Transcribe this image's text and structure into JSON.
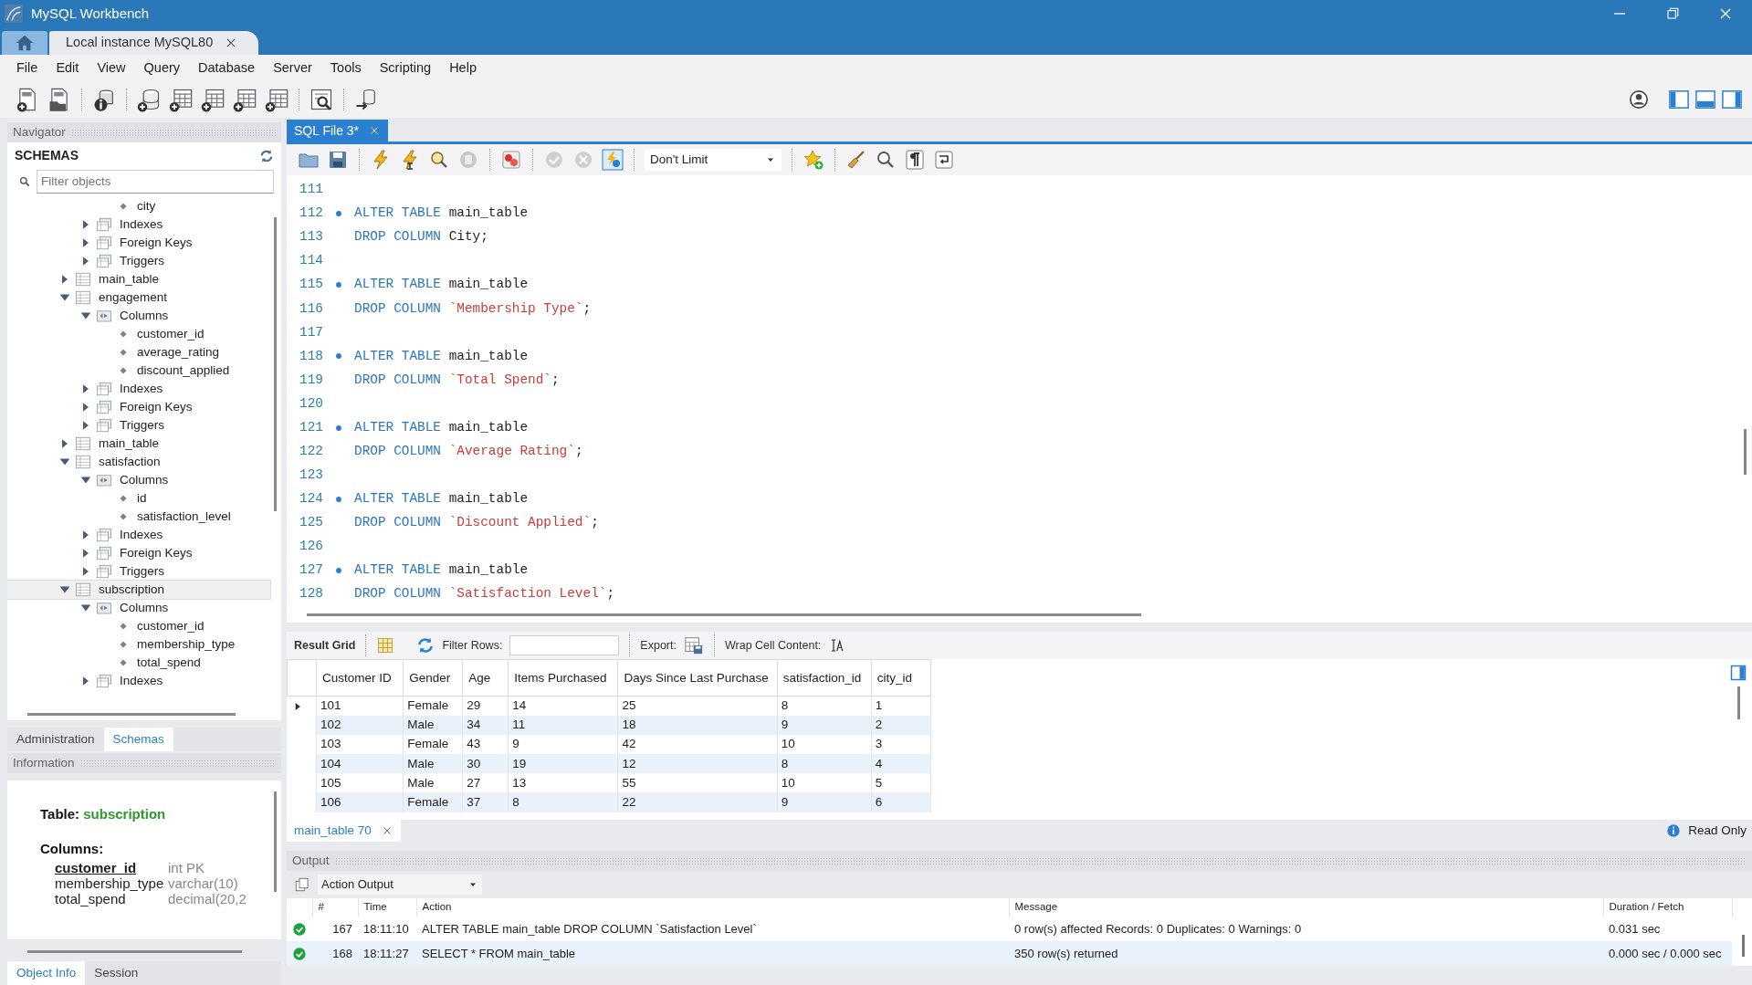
{
  "window": {
    "title": "MySQL Workbench"
  },
  "connection_tabs": [
    {
      "label": "Local instance MySQL80",
      "selected": true
    }
  ],
  "menu": [
    "File",
    "Edit",
    "View",
    "Query",
    "Database",
    "Server",
    "Tools",
    "Scripting",
    "Help"
  ],
  "navigator": {
    "title": "Navigator",
    "schemas_title": "SCHEMAS",
    "filter": {
      "placeholder": "Filter objects"
    },
    "tree": [
      {
        "children": [
          {
            "children": [
              {
                "label": "city",
                "kind": "column",
                "selected": false
              }
            ]
          },
          {
            "label": "Indexes",
            "kind": "group",
            "expanded": false,
            "selected": false
          },
          {
            "label": "Foreign Keys",
            "kind": "group",
            "expanded": false,
            "selected": false
          },
          {
            "label": "Triggers",
            "kind": "group",
            "expanded": false,
            "selected": false
          }
        ]
      },
      {
        "label": "main_table",
        "kind": "table",
        "expanded": false,
        "selected": false
      },
      {
        "label": "engagement",
        "kind": "table",
        "expanded": true,
        "selected": false,
        "children": [
          {
            "label": "Columns",
            "kind": "folder",
            "expanded": true,
            "selected": false,
            "children": [
              {
                "label": "customer_id",
                "kind": "column",
                "selected": false
              },
              {
                "label": "average_rating",
                "kind": "column",
                "selected": false
              },
              {
                "label": "discount_applied",
                "kind": "column",
                "selected": false
              }
            ]
          },
          {
            "label": "Indexes",
            "kind": "group",
            "expanded": false,
            "selected": false
          },
          {
            "label": "Foreign Keys",
            "kind": "group",
            "expanded": false,
            "selected": false
          },
          {
            "label": "Triggers",
            "kind": "group",
            "expanded": false,
            "selected": false
          }
        ]
      },
      {
        "label": "main_table",
        "kind": "table",
        "expanded": false,
        "selected": false
      },
      {
        "label": "satisfaction",
        "kind": "table",
        "expanded": true,
        "selected": false,
        "children": [
          {
            "label": "Columns",
            "kind": "folder",
            "expanded": true,
            "selected": false,
            "children": [
              {
                "label": "id",
                "kind": "column",
                "selected": false
              },
              {
                "label": "satisfaction_level",
                "kind": "column",
                "selected": false
              }
            ]
          },
          {
            "label": "Indexes",
            "kind": "group",
            "expanded": false,
            "selected": false
          },
          {
            "label": "Foreign Keys",
            "kind": "group",
            "expanded": false,
            "selected": false
          },
          {
            "label": "Triggers",
            "kind": "group",
            "expanded": false,
            "selected": false
          }
        ]
      },
      {
        "label": "subscription",
        "kind": "table",
        "expanded": true,
        "selected": true,
        "children": [
          {
            "label": "Columns",
            "kind": "folder",
            "expanded": true,
            "selected": false,
            "children": [
              {
                "label": "customer_id",
                "kind": "column",
                "selected": false
              },
              {
                "label": "membership_type",
                "kind": "column",
                "selected": false
              },
              {
                "label": "total_spend",
                "kind": "column",
                "selected": false
              }
            ]
          },
          {
            "label": "Indexes",
            "kind": "group",
            "expanded": false,
            "selected": false
          }
        ]
      }
    ]
  },
  "sidebar_tabs": [
    {
      "label": "Administration",
      "selected": false
    },
    {
      "label": "Schemas",
      "selected": true
    }
  ],
  "information": {
    "title": "Information",
    "table_label": "Table:",
    "table_name": "subscription",
    "columns_label": "Columns:",
    "columns": [
      {
        "name": "customer_id",
        "type": "int PK",
        "primary_key": true
      },
      {
        "name": "membership_type",
        "type": "varchar(10)",
        "primary_key": false
      },
      {
        "name": "total_spend",
        "type": "decimal(20,2",
        "primary_key": false
      }
    ]
  },
  "bottom_tabs": [
    {
      "label": "Object Info",
      "selected": true
    },
    {
      "label": "Session",
      "selected": false
    }
  ],
  "editor": {
    "tabs": [
      {
        "label": "SQL File 3*",
        "selected": true
      }
    ],
    "limit": "Don't Limit",
    "lines": [
      {
        "number": "111",
        "marker": false
      },
      {
        "number": "112",
        "marker": true,
        "code": [
          {
            "kind": "keyword",
            "text": "ALTER TABLE"
          },
          {
            "kind": "ident",
            "text": "main_table"
          }
        ]
      },
      {
        "number": "113",
        "marker": false,
        "code": [
          {
            "kind": "keyword",
            "text": "DROP COLUMN"
          },
          {
            "kind": "ident",
            "text": "City"
          },
          {
            "kind": "punct",
            "text": ";"
          }
        ]
      },
      {
        "number": "114",
        "marker": false
      },
      {
        "number": "115",
        "marker": true,
        "code": [
          {
            "kind": "keyword",
            "text": "ALTER TABLE"
          },
          {
            "kind": "ident",
            "text": "main_table"
          }
        ]
      },
      {
        "number": "116",
        "marker": false,
        "code": [
          {
            "kind": "keyword",
            "text": "DROP COLUMN"
          },
          {
            "kind": "string",
            "text": "`Membership Type`"
          },
          {
            "kind": "punct",
            "text": ";"
          }
        ]
      },
      {
        "number": "117",
        "marker": false
      },
      {
        "number": "118",
        "marker": true,
        "code": [
          {
            "kind": "keyword",
            "text": "ALTER TABLE"
          },
          {
            "kind": "ident",
            "text": "main_table"
          }
        ]
      },
      {
        "number": "119",
        "marker": false,
        "code": [
          {
            "kind": "keyword",
            "text": "DROP COLUMN"
          },
          {
            "kind": "string",
            "text": "`Total Spend`"
          },
          {
            "kind": "punct",
            "text": ";"
          }
        ]
      },
      {
        "number": "120",
        "marker": false
      },
      {
        "number": "121",
        "marker": true,
        "code": [
          {
            "kind": "keyword",
            "text": "ALTER TABLE"
          },
          {
            "kind": "ident",
            "text": "main_table"
          }
        ]
      },
      {
        "number": "122",
        "marker": false,
        "code": [
          {
            "kind": "keyword",
            "text": "DROP COLUMN"
          },
          {
            "kind": "string",
            "text": "`Average Rating`"
          },
          {
            "kind": "punct",
            "text": ";"
          }
        ]
      },
      {
        "number": "123",
        "marker": false
      },
      {
        "number": "124",
        "marker": true,
        "code": [
          {
            "kind": "keyword",
            "text": "ALTER TABLE"
          },
          {
            "kind": "ident",
            "text": "main_table"
          }
        ]
      },
      {
        "number": "125",
        "marker": false,
        "code": [
          {
            "kind": "keyword",
            "text": "DROP COLUMN"
          },
          {
            "kind": "string",
            "text": "`Discount Applied`"
          },
          {
            "kind": "punct",
            "text": ";"
          }
        ]
      },
      {
        "number": "126",
        "marker": false
      },
      {
        "number": "127",
        "marker": true,
        "code": [
          {
            "kind": "keyword",
            "text": "ALTER TABLE"
          },
          {
            "kind": "ident",
            "text": "main_table"
          }
        ]
      },
      {
        "number": "128",
        "marker": false,
        "code": [
          {
            "kind": "keyword",
            "text": "DROP COLUMN"
          },
          {
            "kind": "string",
            "text": "`Satisfaction Level`"
          },
          {
            "kind": "punct",
            "text": ";"
          }
        ]
      }
    ]
  },
  "results": {
    "title": "Result Grid",
    "filter_label": "Filter Rows:",
    "export_label": "Export:",
    "wrap_label": "Wrap Cell Content:",
    "columns": [
      "Customer ID",
      "Gender",
      "Age",
      "Items Purchased",
      "Days Since Last Purchase",
      "satisfaction_id",
      "city_id"
    ],
    "rows": [
      {
        "current": true,
        "cells": [
          "101",
          "Female",
          "29",
          "14",
          "25",
          "8",
          "1"
        ]
      },
      {
        "current": false,
        "cells": [
          "102",
          "Male",
          "34",
          "11",
          "18",
          "9",
          "2"
        ]
      },
      {
        "current": false,
        "cells": [
          "103",
          "Female",
          "43",
          "9",
          "42",
          "10",
          "3"
        ]
      },
      {
        "current": false,
        "cells": [
          "104",
          "Male",
          "30",
          "19",
          "12",
          "8",
          "4"
        ]
      },
      {
        "current": false,
        "cells": [
          "105",
          "Male",
          "27",
          "13",
          "55",
          "10",
          "5"
        ]
      },
      {
        "current": false,
        "cells": [
          "106",
          "Female",
          "37",
          "8",
          "22",
          "9",
          "6"
        ]
      }
    ],
    "tabs": [
      {
        "label": "main_table 70",
        "selected": true
      }
    ],
    "read_only": "Read Only"
  },
  "output": {
    "title": "Output",
    "mode": "Action Output",
    "columns": [
      "#",
      "Time",
      "Action",
      "Message",
      "Duration / Fetch"
    ],
    "rows": [
      {
        "number": "167",
        "time": "18:11:10",
        "action": "ALTER TABLE main_table DROP COLUMN `Satisfaction Level`",
        "message": "0 row(s) affected Records: 0  Duplicates: 0  Warnings: 0",
        "duration": "0.031 sec"
      },
      {
        "number": "168",
        "time": "18:11:27",
        "action": "SELECT * FROM main_table",
        "message": "350 row(s) returned",
        "duration": "0.000 sec / 0.000 sec"
      }
    ]
  }
}
